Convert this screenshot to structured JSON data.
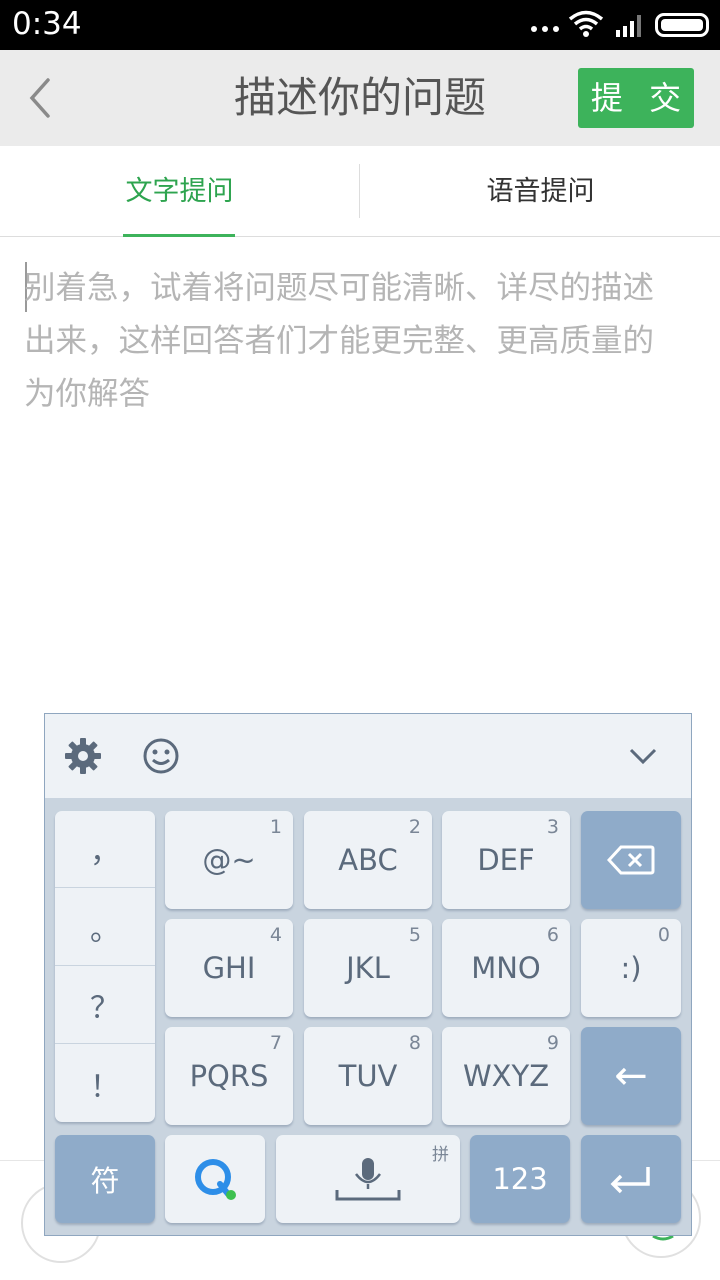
{
  "status_bar": {
    "time": "0:34",
    "icons": [
      "more-dots-icon",
      "wifi-icon",
      "signal-icon",
      "battery-icon"
    ]
  },
  "header": {
    "title": "描述你的问题",
    "submit_label": "提 交",
    "back_icon": "chevron-left-icon"
  },
  "tabs": [
    {
      "label": "文字提问",
      "active": true
    },
    {
      "label": "语音提问",
      "active": false
    }
  ],
  "editor": {
    "placeholder": "别着急，试着将问题尽可能清晰、详尽的描述出来，这样回答者们才能更完整、更高质量的为你解答",
    "value": ""
  },
  "keyboard": {
    "toolbar_icons": [
      "gear-icon",
      "smiley-icon",
      "chevron-down-icon"
    ],
    "punctuation": [
      "，",
      "。",
      "？",
      "！"
    ],
    "rows": [
      [
        {
          "label": "@~",
          "num": "1"
        },
        {
          "label": "ABC",
          "num": "2"
        },
        {
          "label": "DEF",
          "num": "3"
        },
        {
          "label": "⌫",
          "num": ""
        }
      ],
      [
        {
          "label": "GHI",
          "num": "4"
        },
        {
          "label": "JKL",
          "num": "5"
        },
        {
          "label": "MNO",
          "num": "6"
        },
        {
          "label": ":)",
          "num": "0"
        }
      ],
      [
        {
          "label": "PQRS",
          "num": "7"
        },
        {
          "label": "TUV",
          "num": "8"
        },
        {
          "label": "WXYZ",
          "num": "9"
        },
        {
          "label": "←",
          "num": ""
        }
      ]
    ],
    "bottom_row": {
      "symbols_label": "符",
      "pinyin_tag": "拼",
      "numbers_label": "123",
      "enter_icon": "enter-icon",
      "mic_icon": "microphone-icon",
      "logo_icon": "q-logo-icon"
    }
  },
  "colors": {
    "accent": "#3db35b",
    "header_bg": "#ebebeb",
    "keyboard_bg": "#c9d4df",
    "key_dark": "#8fabc9"
  }
}
